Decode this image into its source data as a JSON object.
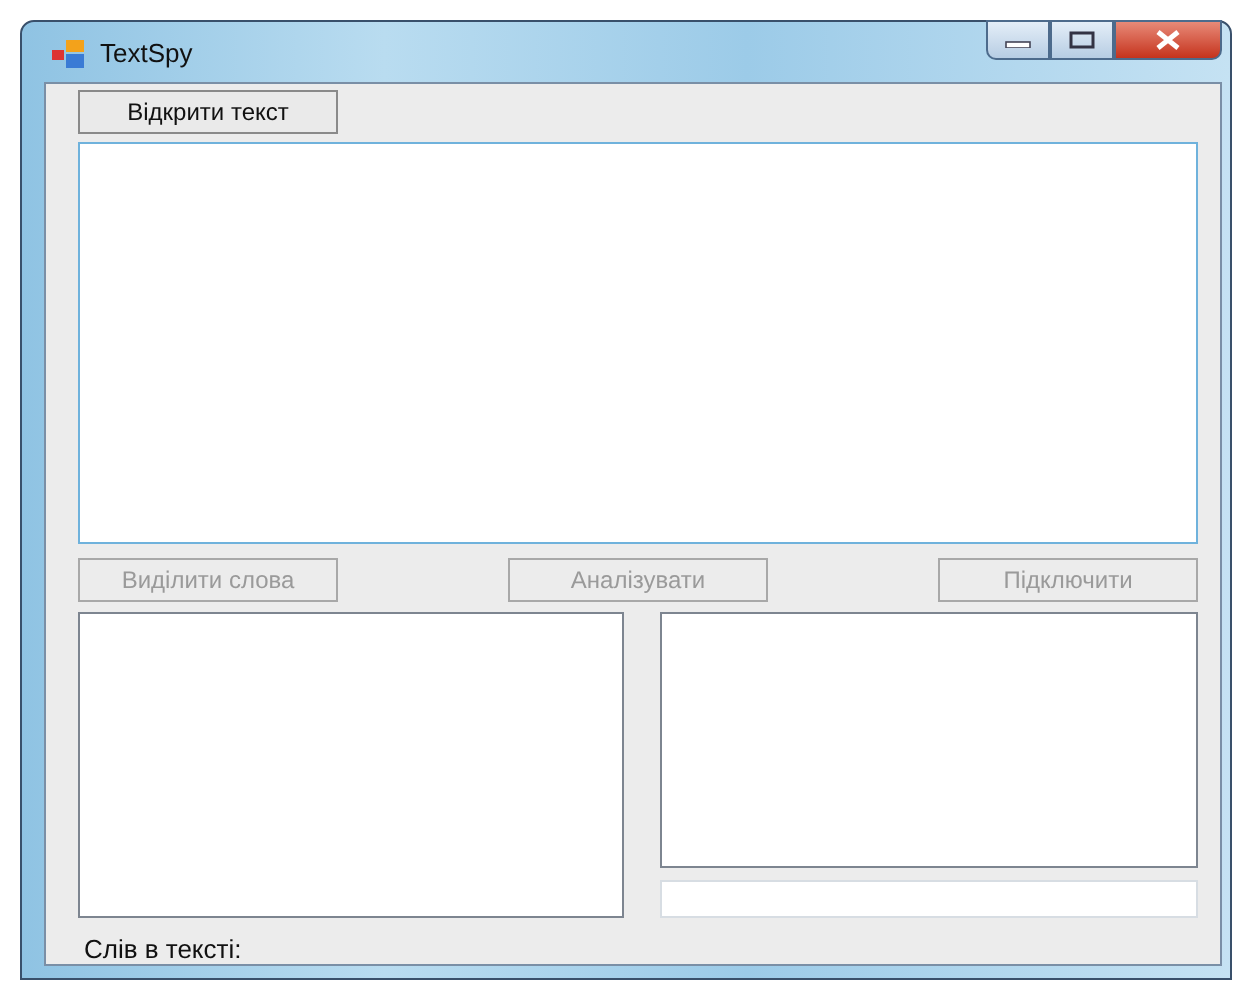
{
  "window": {
    "title": "TextSpy"
  },
  "open_button": {
    "label": "Відкрити текст",
    "disabled": false
  },
  "buttons": [
    {
      "label": "Виділити слова",
      "disabled": true
    },
    {
      "label": "Аналізувати",
      "disabled": true
    },
    {
      "label": "Підключити",
      "disabled": true
    }
  ],
  "status_label": "Слів в тексті:"
}
